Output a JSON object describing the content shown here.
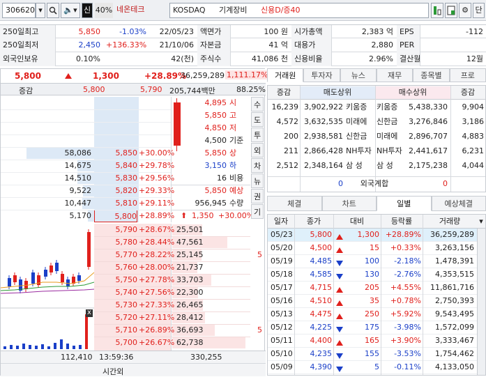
{
  "toolbar": {
    "code": "306620",
    "sin_label": "신",
    "percent_label": "40%",
    "name": "네온테크",
    "market": "KOSDAQ",
    "sector": "기계장비",
    "credit": "신용D/증40",
    "dan_label": "단"
  },
  "info": {
    "rows": [
      {
        "l1": "250일최고",
        "v1": "5,850",
        "p1": "-1.03%",
        "d1": "22/05/23",
        "l2": "액면가",
        "v2": "100 원",
        "l3": "시가총액",
        "v3": "2,383 억",
        "l4": "EPS",
        "v4": "-112"
      },
      {
        "l1": "250일최저",
        "v1": "2,450",
        "p1": "+136.33%",
        "d1": "21/10/06",
        "l2": "자본금",
        "v2": "41 억",
        "l3": "대용가",
        "v3": "2,880",
        "l4": "PER",
        "v4": ""
      },
      {
        "l1": "외국인보유",
        "v1": "0.10%",
        "p1": "",
        "d1": "42(천)",
        "l2": "주식수",
        "v2": "41,086 천",
        "l3": "신용비율",
        "v3": "2.96%",
        "l4": "결산월",
        "v4": "12월"
      }
    ]
  },
  "quote": {
    "price": "5,800",
    "change": "1,300",
    "rate": "+28.89%",
    "volume": "36,259,289",
    "vol_rate": "1,111.17%",
    "diff_label": "증감",
    "diff_sell": "5,800",
    "diff_buy": "5,790",
    "trade_amt": "205,744백만",
    "strength": "88.25%"
  },
  "ask_rows": [
    {
      "qty": "",
      "price": "",
      "rate": ""
    },
    {
      "qty": "",
      "price": "",
      "rate": ""
    },
    {
      "qty": "",
      "price": "",
      "rate": ""
    },
    {
      "qty": "",
      "price": "",
      "rate": ""
    },
    {
      "qty": "58,086",
      "price": "5,850",
      "rate": "+30.00%"
    },
    {
      "qty": "14,675",
      "price": "5,840",
      "rate": "+29.78%"
    },
    {
      "qty": "14,510",
      "price": "5,830",
      "rate": "+29.56%"
    },
    {
      "qty": "9,522",
      "price": "5,820",
      "rate": "+29.33%"
    },
    {
      "qty": "10,447",
      "price": "5,810",
      "rate": "+29.11%"
    },
    {
      "qty": "5,170",
      "price": "5,800",
      "rate": "+28.89%"
    }
  ],
  "summary_rows": [
    {
      "value": "4,895",
      "label": "시",
      "color": "red"
    },
    {
      "value": "5,850",
      "label": "고",
      "color": "red"
    },
    {
      "value": "4,850",
      "label": "저",
      "color": "red"
    },
    {
      "value": "4,500",
      "label": "기준",
      "color": "black"
    },
    {
      "value": "5,850",
      "label": "상",
      "color": "red"
    },
    {
      "value": "3,150",
      "label": "하",
      "color": "blue"
    },
    {
      "value": "16",
      "label": "비용",
      "color": "black"
    },
    {
      "value": "5,850",
      "label": "예상",
      "color": "red"
    },
    {
      "value": "956,945",
      "label": "수량",
      "color": "black"
    }
  ],
  "expected": {
    "change": "1,350",
    "rate": "+30.00%"
  },
  "side_tabs": [
    "수",
    "도",
    "투",
    "외",
    "차",
    "뉴",
    "권",
    "기"
  ],
  "bid_rows": [
    {
      "price": "5,790",
      "rate": "+28.67%",
      "qty": "25,501"
    },
    {
      "price": "5,780",
      "rate": "+28.44%",
      "qty": "47,561"
    },
    {
      "price": "5,770",
      "rate": "+28.22%",
      "qty": "25,145"
    },
    {
      "price": "5,760",
      "rate": "+28.00%",
      "qty": "21,737"
    },
    {
      "price": "5,750",
      "rate": "+27.78%",
      "qty": "33,703"
    },
    {
      "price": "5,740",
      "rate": "+27.56%",
      "qty": "22,300"
    },
    {
      "price": "5,730",
      "rate": "+27.33%",
      "qty": "26,465"
    },
    {
      "price": "5,720",
      "rate": "+27.11%",
      "qty": "28,412"
    },
    {
      "price": "5,710",
      "rate": "+26.89%",
      "qty": "36,693"
    },
    {
      "price": "5,700",
      "rate": "+26.67%",
      "qty": "62,738"
    }
  ],
  "bid_marker": "5",
  "bid_marker2": "5",
  "chart_close_label": "x",
  "footer": {
    "ask_total": "112,410",
    "time": "13:59:36",
    "bid_total": "330,255",
    "after_hours": "시간외"
  },
  "broker": {
    "tabs": [
      "거래원",
      "투자자",
      "뉴스",
      "재무",
      "종목별",
      "프로"
    ],
    "head": {
      "diff": "증감",
      "sell": "매도상위",
      "buy": "매수상위",
      "diff2": "증감"
    },
    "rows": [
      {
        "d1": "16,239",
        "s": "3,902,922",
        "sn": "키움증",
        "bn": "키움증",
        "b": "5,438,330",
        "d2": "9,904"
      },
      {
        "d1": "4,572",
        "s": "3,632,535",
        "sn": "미래에",
        "bn": "신한금",
        "b": "3,276,846",
        "d2": "3,186"
      },
      {
        "d1": "200",
        "s": "2,938,581",
        "sn": "신한금",
        "bn": "미래에",
        "b": "2,896,707",
        "d2": "4,883"
      },
      {
        "d1": "211",
        "s": "2,866,428",
        "sn": "NH투자",
        "bn": "NH투자",
        "b": "2,441,617",
        "d2": "6,231"
      },
      {
        "d1": "2,512",
        "s": "2,348,164",
        "sn": "삼 성",
        "bn": "삼 성",
        "b": "2,175,238",
        "d2": "4,044"
      }
    ],
    "foreign": {
      "sell": "0",
      "label": "외국계합",
      "buy": "0"
    }
  },
  "daily": {
    "tabs": [
      "체결",
      "차트",
      "일별",
      "예상체결"
    ],
    "head": [
      "일자",
      "종가",
      "대비",
      "등락률",
      "거래량"
    ],
    "rows": [
      {
        "date": "05/23",
        "close": "5,800",
        "dir": "up",
        "chg": "1,300",
        "rate": "+28.89%",
        "vol": "36,259,289"
      },
      {
        "date": "05/20",
        "close": "4,500",
        "dir": "up",
        "chg": "15",
        "rate": "+0.33%",
        "vol": "3,263,156"
      },
      {
        "date": "05/19",
        "close": "4,485",
        "dir": "down",
        "chg": "100",
        "rate": "-2.18%",
        "vol": "1,478,391"
      },
      {
        "date": "05/18",
        "close": "4,585",
        "dir": "down",
        "chg": "130",
        "rate": "-2.76%",
        "vol": "4,353,515"
      },
      {
        "date": "05/17",
        "close": "4,715",
        "dir": "up",
        "chg": "205",
        "rate": "+4.55%",
        "vol": "11,861,716"
      },
      {
        "date": "05/16",
        "close": "4,510",
        "dir": "up",
        "chg": "35",
        "rate": "+0.78%",
        "vol": "2,750,393"
      },
      {
        "date": "05/13",
        "close": "4,475",
        "dir": "up",
        "chg": "250",
        "rate": "+5.92%",
        "vol": "9,543,495"
      },
      {
        "date": "05/12",
        "close": "4,225",
        "dir": "down",
        "chg": "175",
        "rate": "-3.98%",
        "vol": "1,572,099"
      },
      {
        "date": "05/11",
        "close": "4,400",
        "dir": "up",
        "chg": "165",
        "rate": "+3.90%",
        "vol": "3,333,467"
      },
      {
        "date": "05/10",
        "close": "4,235",
        "dir": "down",
        "chg": "155",
        "rate": "-3.53%",
        "vol": "1,754,462"
      },
      {
        "date": "05/09",
        "close": "4,390",
        "dir": "down",
        "chg": "5",
        "rate": "-0.11%",
        "vol": "4,133,050"
      }
    ]
  },
  "colors": {
    "up": "#e0201c",
    "down": "#1a3fc8",
    "ask_bg": "#dde9f6",
    "bid_bg": "#fbe4e4"
  }
}
